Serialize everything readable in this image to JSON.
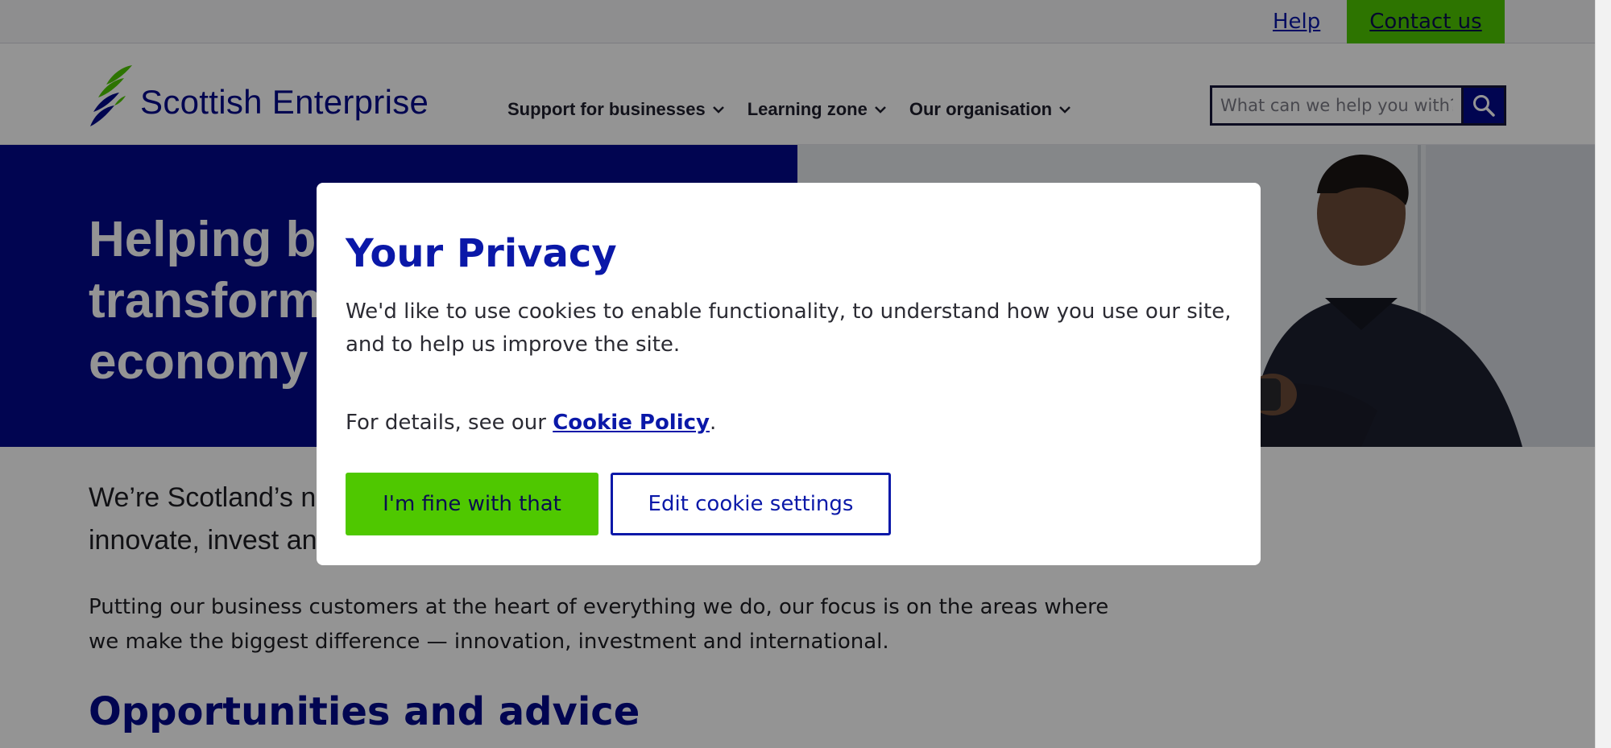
{
  "utility_bar": {
    "help_label": "Help",
    "contact_label": "Contact us"
  },
  "header": {
    "brand_name": "Scottish Enterprise",
    "nav": [
      {
        "label": "Support for businesses"
      },
      {
        "label": "Learning zone"
      },
      {
        "label": "Our organisation"
      }
    ],
    "search": {
      "placeholder": "What can we help you with?"
    }
  },
  "hero": {
    "title": "Helping businesses transform Scotland's economy"
  },
  "main": {
    "intro": "We’re Scotland’s national economic development agency. We work with businesses to innovate, invest and internationalise.",
    "body": "Putting our business customers at the heart of everything we do, our focus is on the areas where we make the biggest difference — innovation, investment and international.",
    "section_title": "Opportunities and advice"
  },
  "cookie_modal": {
    "title": "Your Privacy",
    "body": "We'd like to use cookies to enable functionality, to understand how you use our site, and to help us improve the site.",
    "details_prefix": "For details, see our ",
    "policy_link": "Cookie Policy",
    "details_suffix": ".",
    "accept_label": "I'm fine with that",
    "settings_label": "Edit cookie settings"
  },
  "colors": {
    "brand_blue": "#030a8c",
    "link_blue": "#0a18a8",
    "accent_green": "#4fc800"
  }
}
